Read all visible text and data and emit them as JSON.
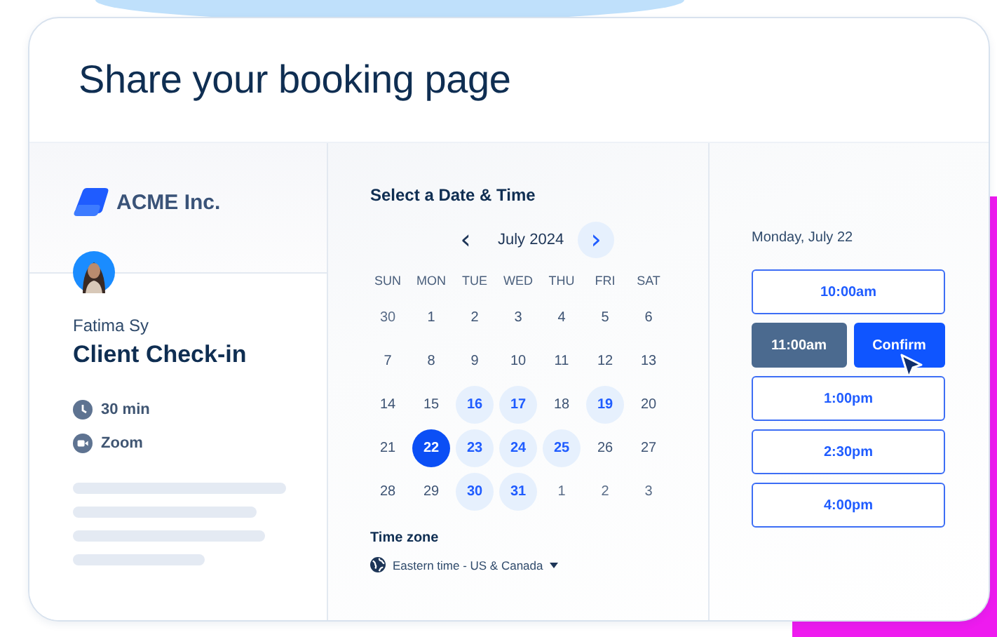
{
  "title": "Share your booking page",
  "profile": {
    "company": "ACME Inc.",
    "host": "Fatima Sy",
    "event": "Client Check-in",
    "details": [
      {
        "kind": "duration",
        "text": "30 min"
      },
      {
        "kind": "video",
        "text": "Zoom"
      }
    ]
  },
  "calendar": {
    "heading": "Select a Date & Time",
    "month": "July 2024",
    "prev": "‹",
    "next": "›",
    "weekdays": [
      "SUN",
      "MON",
      "TUE",
      "WED",
      "THU",
      "FRI",
      "SAT"
    ],
    "days": [
      {
        "label": "30",
        "kind": "outside",
        "selected": false
      },
      {
        "label": "1",
        "kind": "plain",
        "selected": false
      },
      {
        "label": "2",
        "kind": "plain",
        "selected": false
      },
      {
        "label": "3",
        "kind": "plain",
        "selected": false
      },
      {
        "label": "4",
        "kind": "plain",
        "selected": false
      },
      {
        "label": "5",
        "kind": "plain",
        "selected": false
      },
      {
        "label": "6",
        "kind": "plain",
        "selected": false
      },
      {
        "label": "7",
        "kind": "plain",
        "selected": false
      },
      {
        "label": "8",
        "kind": "plain",
        "selected": false
      },
      {
        "label": "9",
        "kind": "plain",
        "selected": false
      },
      {
        "label": "10",
        "kind": "plain",
        "selected": false
      },
      {
        "label": "11",
        "kind": "plain",
        "selected": false
      },
      {
        "label": "12",
        "kind": "plain",
        "selected": false
      },
      {
        "label": "13",
        "kind": "plain",
        "selected": false
      },
      {
        "label": "14",
        "kind": "plain",
        "selected": false
      },
      {
        "label": "15",
        "kind": "plain",
        "selected": false
      },
      {
        "label": "16",
        "kind": "available",
        "selected": false
      },
      {
        "label": "17",
        "kind": "available",
        "selected": false
      },
      {
        "label": "18",
        "kind": "plain",
        "selected": false
      },
      {
        "label": "19",
        "kind": "available",
        "selected": false
      },
      {
        "label": "20",
        "kind": "plain",
        "selected": false
      },
      {
        "label": "21",
        "kind": "plain",
        "selected": false
      },
      {
        "label": "22",
        "kind": "available",
        "selected": true
      },
      {
        "label": "23",
        "kind": "available",
        "selected": false
      },
      {
        "label": "24",
        "kind": "available",
        "selected": false
      },
      {
        "label": "25",
        "kind": "available",
        "selected": false
      },
      {
        "label": "26",
        "kind": "plain",
        "selected": false
      },
      {
        "label": "27",
        "kind": "plain",
        "selected": false
      },
      {
        "label": "28",
        "kind": "plain",
        "selected": false
      },
      {
        "label": "29",
        "kind": "plain",
        "selected": false
      },
      {
        "label": "30",
        "kind": "available",
        "selected": false
      },
      {
        "label": "31",
        "kind": "available",
        "selected": false
      },
      {
        "label": "1",
        "kind": "outside",
        "selected": false
      },
      {
        "label": "2",
        "kind": "outside",
        "selected": false
      },
      {
        "label": "3",
        "kind": "outside",
        "selected": false
      }
    ],
    "timezone_label": "Time zone",
    "timezone": "Eastern time - US & Canada"
  },
  "times": {
    "date": "Monday, July 22",
    "confirm": "Confirm",
    "slots": [
      {
        "label": "10:00am",
        "selected": false
      },
      {
        "label": "11:00am",
        "selected": true
      },
      {
        "label": "1:00pm",
        "selected": false
      },
      {
        "label": "2:30pm",
        "selected": false
      },
      {
        "label": "4:00pm",
        "selected": false
      }
    ]
  }
}
